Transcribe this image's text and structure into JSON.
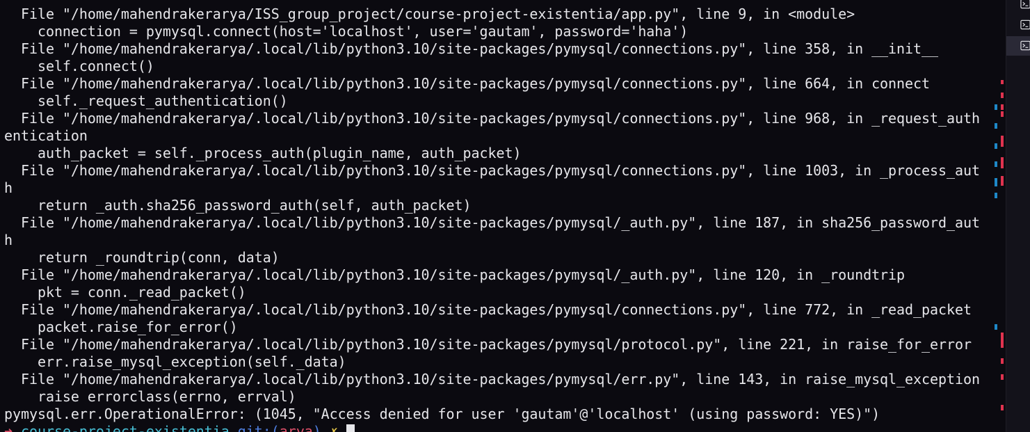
{
  "terminal": {
    "lines": [
      "  File \"/home/mahendrakerarya/ISS_group_project/course-project-existentia/app.py\", line 9, in <module>",
      "    connection = pymysql.connect(host='localhost', user='gautam', password='haha')",
      "  File \"/home/mahendrakerarya/.local/lib/python3.10/site-packages/pymysql/connections.py\", line 358, in __init__",
      "    self.connect()",
      "  File \"/home/mahendrakerarya/.local/lib/python3.10/site-packages/pymysql/connections.py\", line 664, in connect",
      "    self._request_authentication()",
      "  File \"/home/mahendrakerarya/.local/lib/python3.10/site-packages/pymysql/connections.py\", line 968, in _request_auth",
      "entication",
      "    auth_packet = self._process_auth(plugin_name, auth_packet)",
      "  File \"/home/mahendrakerarya/.local/lib/python3.10/site-packages/pymysql/connections.py\", line 1003, in _process_aut",
      "h",
      "    return _auth.sha256_password_auth(self, auth_packet)",
      "  File \"/home/mahendrakerarya/.local/lib/python3.10/site-packages/pymysql/_auth.py\", line 187, in sha256_password_aut",
      "h",
      "    return _roundtrip(conn, data)",
      "  File \"/home/mahendrakerarya/.local/lib/python3.10/site-packages/pymysql/_auth.py\", line 120, in _roundtrip",
      "    pkt = conn._read_packet()",
      "  File \"/home/mahendrakerarya/.local/lib/python3.10/site-packages/pymysql/connections.py\", line 772, in _read_packet",
      "    packet.raise_for_error()",
      "  File \"/home/mahendrakerarya/.local/lib/python3.10/site-packages/pymysql/protocol.py\", line 221, in raise_for_error",
      "    err.raise_mysql_exception(self._data)",
      "  File \"/home/mahendrakerarya/.local/lib/python3.10/site-packages/pymysql/err.py\", line 143, in raise_mysql_exception",
      "    raise errorclass(errno, errval)",
      "pymysql.err.OperationalError: (1045, \"Access denied for user 'gautam'@'localhost' (using password: YES)\")"
    ],
    "prompt": {
      "arrow": "➜",
      "directory": "course-project-existentia",
      "git_label": "git:(",
      "branch": "arya",
      "git_close": ")",
      "dirty_marker": "✗"
    }
  },
  "side_panel": {
    "tabs": [
      {
        "icon": "terminal-icon",
        "active": false
      },
      {
        "icon": "terminal-icon",
        "active": false
      },
      {
        "icon": "terminal-icon",
        "active": true
      }
    ]
  },
  "colors": {
    "background": "#0b0a10",
    "foreground": "#e6e6ea",
    "error_marker": "#e0334f",
    "info_marker": "#1e88c8",
    "prompt_directory": "#48c0d6",
    "prompt_branch": "#e0506a"
  }
}
